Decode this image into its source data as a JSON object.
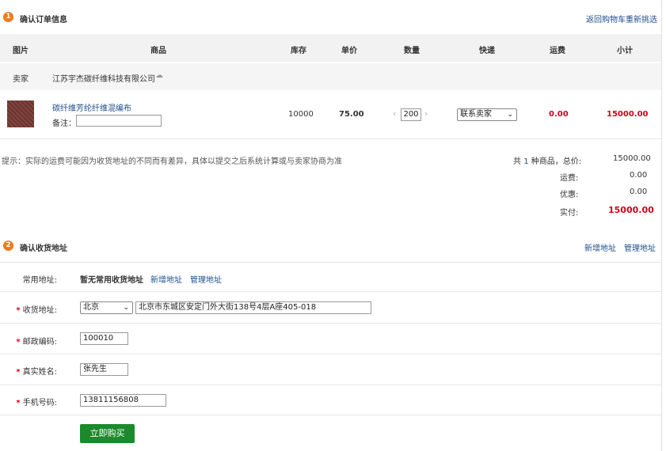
{
  "section1": {
    "step": "1",
    "title": "确认订单信息",
    "back_link": "返回购物车重新挑选"
  },
  "table": {
    "headers": [
      "图片",
      "商品",
      "库存",
      "单价",
      "数量",
      "快递",
      "运费",
      "小计"
    ],
    "seller_label": "卖家",
    "seller_name": "江苏宇杰碳纤维科技有限公司",
    "item": {
      "name": "碳纤维芳纶纤维混编布",
      "remark_label": "备注：",
      "remark_value": "",
      "stock": "10000",
      "price": "75.00",
      "qty": "200",
      "dec": "‹",
      "inc": "›",
      "shipping_method": "联系卖家",
      "shipping_fee": "0.00",
      "subtotal": "15000.00"
    }
  },
  "summary": {
    "tip": "提示：实际的运费可能因为收货地址的不同而有差异，具体以提交之后系统计算或与卖家协商为准",
    "count_prefix": "共",
    "count": "1",
    "count_suffix": "种商品，总价:",
    "total": "15000.00",
    "freight_label": "运费:",
    "freight": "0.00",
    "discount_label": "优惠:",
    "discount": "0.00",
    "paid_label": "实付:",
    "paid": "15000.00"
  },
  "section2": {
    "step": "2",
    "title": "确认收货地址",
    "add_link": "新增地址",
    "manage_link": "管理地址"
  },
  "address_form": {
    "common_label": "常用地址:",
    "common_value": "暂无常用收货地址",
    "common_add": "新增地址",
    "common_manage": "管理地址",
    "addr_label": "收货地址:",
    "province": "北京",
    "addr_value": "北京市东城区安定门外大街138号4层A座405-018",
    "zip_label": "邮政编码:",
    "zip_value": "100010",
    "name_label": "真实姓名:",
    "name_value": "张先生",
    "phone_label": "手机号码:",
    "phone_value": "13811156808",
    "submit": "立即购买",
    "required": "*"
  },
  "colors": {
    "accent": "#f07a1a",
    "price_red": "#d0021b",
    "button_green": "#1a8a2c",
    "link": "#1f4e8a"
  }
}
